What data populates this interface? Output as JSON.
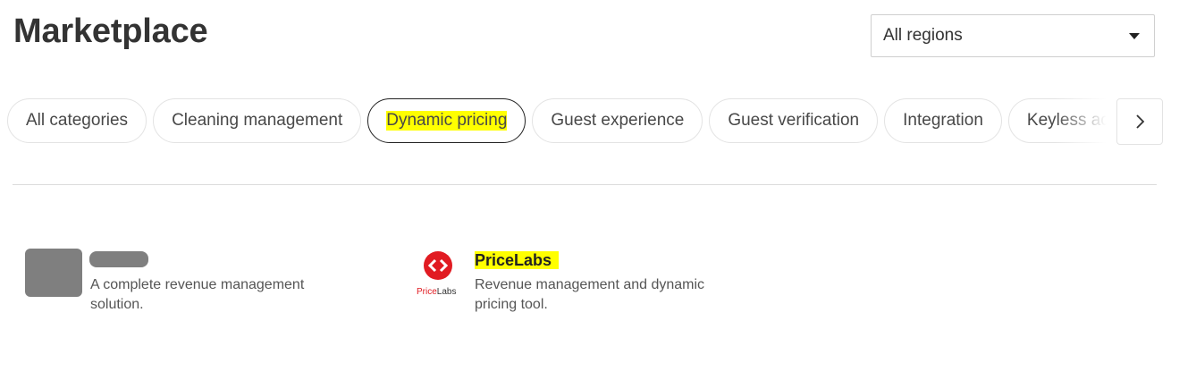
{
  "page": {
    "title": "Marketplace"
  },
  "region_select": {
    "value": "All regions",
    "caret_icon": "caret-down-icon"
  },
  "categories": [
    {
      "label": "All categories",
      "active": false
    },
    {
      "label": "Cleaning management",
      "active": false
    },
    {
      "label": "Dynamic pricing",
      "active": true
    },
    {
      "label": "Guest experience",
      "active": false
    },
    {
      "label": "Guest verification",
      "active": false
    },
    {
      "label": "Integration",
      "active": false
    },
    {
      "label": "Keyless access",
      "active": false
    }
  ],
  "next_button": {
    "icon": "chevron-right-icon"
  },
  "apps": [
    {
      "name": "",
      "description": "A complete revenue management solution.",
      "redacted": true
    },
    {
      "name": "PriceLabs",
      "description": "Revenue management and dynamic pricing tool.",
      "logo_text_a": "Price",
      "logo_text_b": "Labs",
      "logo_color": "#e11b22"
    }
  ],
  "colors": {
    "highlight": "#ffff00",
    "active_chip_border": "#222222"
  }
}
